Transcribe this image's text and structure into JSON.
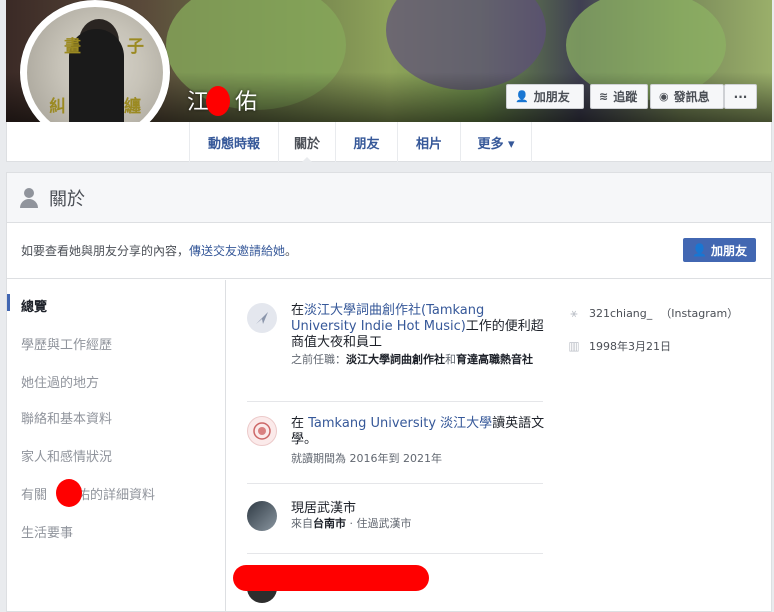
{
  "profile": {
    "name_first": "江",
    "name_last": "佑",
    "avatar_text": [
      "畫",
      "子",
      "糾",
      "纏"
    ]
  },
  "header_buttons": {
    "add_friend": "加朋友",
    "follow": "追蹤",
    "message": "發訊息",
    "more": "···"
  },
  "tabs": [
    {
      "label": "動態時報"
    },
    {
      "label": "關於"
    },
    {
      "label": "朋友"
    },
    {
      "label": "相片"
    },
    {
      "label": "更多 ▾"
    }
  ],
  "about": {
    "title": "關於",
    "friend_prompt": "如要查看她與朋友分享的內容，",
    "friend_prompt_link": "傳送交友邀請給她",
    "friend_prompt_end": "。",
    "friend_button": "加朋友"
  },
  "nav": {
    "overview": "總覽",
    "education_work": "學歷與工作經歷",
    "places": "她住過的地方",
    "contact": "聯絡和基本資料",
    "family": "家人和感情狀況",
    "details_prefix": "有關",
    "details_suffix": "佑的詳細資料",
    "life_events": "生活要事"
  },
  "overview": {
    "work_line1_prefix": "在",
    "work_line1_link": "淡江大學詞曲創作社(Tamkang University Indie Hot Music)",
    "work_line1_suffix": "工作的便利超商值大夜和員工",
    "work_line2_prefix": "之前任職：",
    "work_line2_org1": "淡江大學詞曲創作社",
    "work_line2_and": "和",
    "work_line2_org2": "育達高職熱音社",
    "edu_line1_prefix": "在 ",
    "edu_line1_link": "Tamkang University 淡江大學",
    "edu_line1_suffix": "讀英語文學。",
    "edu_line2": "就讀期間為 2016年到 2021年",
    "home_line1": "現居武漢市",
    "home_line2_prefix": "來自",
    "home_line2_city": "台南市",
    "home_line2_suffix": " · 住過武漢市"
  },
  "side": {
    "instagram_handle": "321chiang_",
    "instagram_label": "（Instagram）",
    "birthday": "1998年3月21日"
  }
}
